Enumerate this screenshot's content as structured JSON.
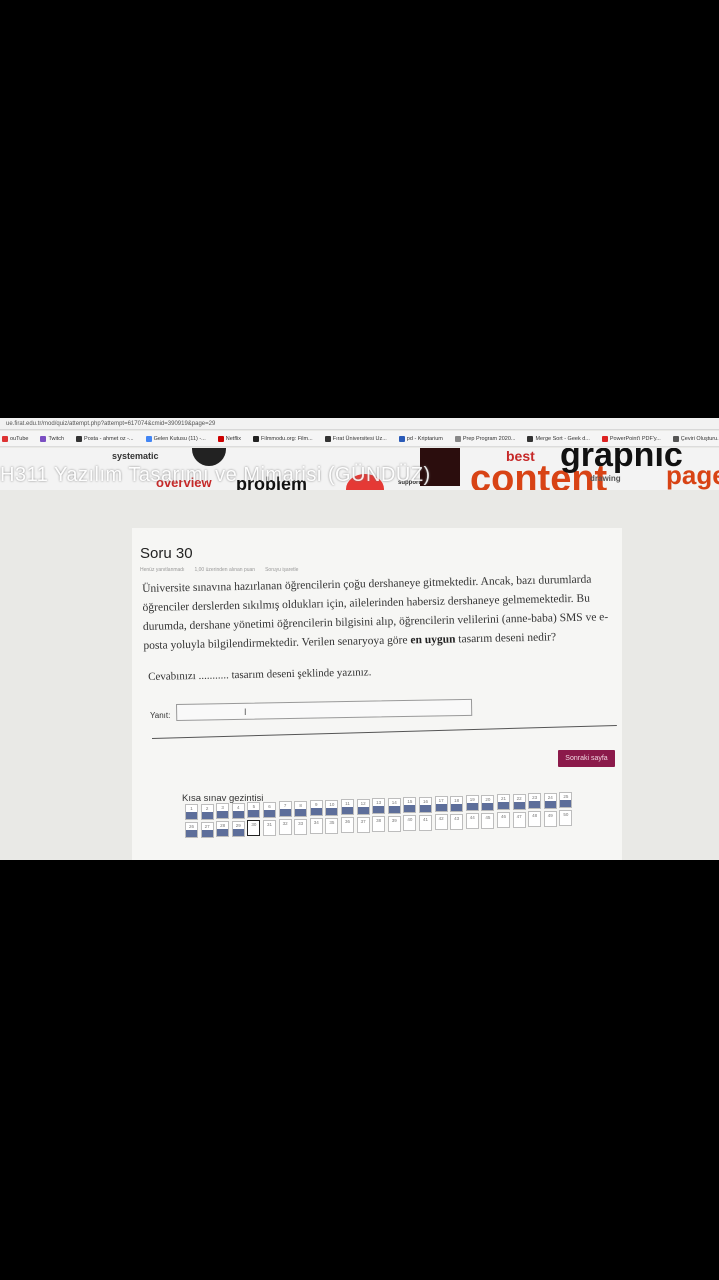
{
  "browser": {
    "url": "ue.firat.edu.tr/mod/quiz/attempt.php?attempt=617074&cmid=390919&page=29",
    "bookmarks": [
      {
        "label": "ouTube",
        "icon": "youtube-icon",
        "color": "#d33"
      },
      {
        "label": "Twitch",
        "icon": "twitch-icon",
        "color": "#7a4ec2"
      },
      {
        "label": "Posta - ahmet oz -...",
        "icon": "mail-icon",
        "color": "#333"
      },
      {
        "label": "Gelen Kutusu (11) -...",
        "icon": "google-icon",
        "color": "#4285f4"
      },
      {
        "label": "Netflix",
        "icon": "netflix-icon",
        "color": "#c00"
      },
      {
        "label": "Filmmodu.org: Film...",
        "icon": "film-icon",
        "color": "#222"
      },
      {
        "label": "Fırat Üniversitesi Uz...",
        "icon": "university-icon",
        "color": "#333"
      },
      {
        "label": "pd - Kriptarium",
        "icon": "w-icon",
        "color": "#2a5ab8"
      },
      {
        "label": "Prep Program 2020...",
        "icon": "doc-icon",
        "color": "#888"
      },
      {
        "label": "Merge Sort - Geek d...",
        "icon": "gfg-icon",
        "color": "#333"
      },
      {
        "label": "PowerPoint'i PDF'y...",
        "icon": "pdf-icon",
        "color": "#d22"
      },
      {
        "label": "Çeviri Oluşturu...",
        "icon": "grid-icon",
        "color": "#555"
      }
    ]
  },
  "course": {
    "title": "H311 Yazılım Tasarımı ve Mimarisi (GÜNDÜZ)",
    "banner_words": [
      "systematic",
      "overview",
      "problem",
      "best",
      "content",
      "supports",
      "graphic",
      "drawing",
      "page"
    ]
  },
  "question": {
    "title": "Soru 30",
    "meta": [
      "Henüz yanıtlanmadı",
      "1,00 üzerinden alınan puan",
      "Soruyu işaretle"
    ],
    "text_part1": "Üniversite sınavına hazırlanan öğrencilerin çoğu dershaneye gitmektedir. Ancak, bazı durumlarda öğrenciler derslerden sıkılmış oldukları için, ailelerinden habersiz dershaneye gelmemektedir. Bu durumda, dershane yönetimi öğrencilerin bilgisini alıp, öğrencilerin velilerini (anne-baba) SMS ve e-posta yoluyla bilgilendirmektedir. Verilen senaryoya göre",
    "text_bold": "en uygun",
    "text_part2": "tasarım deseni nedir?",
    "hint": "Cevabınızı ........... tasarım deseni şeklinde yazınız.",
    "answer_label": "Yanıt:",
    "answer_value": "",
    "next_button": "Sonraki sayfa"
  },
  "navigation": {
    "title": "Kısa sınav gezintisi",
    "current": 30,
    "answered_count": 29,
    "total": 50
  }
}
